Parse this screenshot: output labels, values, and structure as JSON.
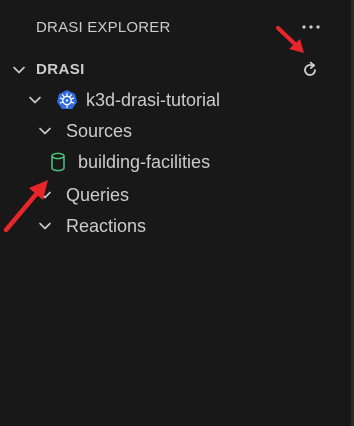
{
  "panel": {
    "title": "DRASI EXPLORER",
    "more_icon": "ellipsis-icon"
  },
  "section": {
    "title": "DRASI",
    "refresh_icon": "refresh-icon"
  },
  "tree": {
    "cluster": {
      "label": "k3d-drasi-tutorial",
      "icon": "kubernetes-icon"
    },
    "sources": {
      "label": "Sources",
      "items": [
        {
          "label": "building-facilities",
          "icon": "database-icon"
        }
      ]
    },
    "queries": {
      "label": "Queries"
    },
    "reactions": {
      "label": "Reactions"
    }
  },
  "colors": {
    "background": "#181818",
    "text": "#cccccc",
    "kubernetes_blue": "#326ce5",
    "database_green": "#4ec27a",
    "arrow_red": "#e8262a"
  }
}
